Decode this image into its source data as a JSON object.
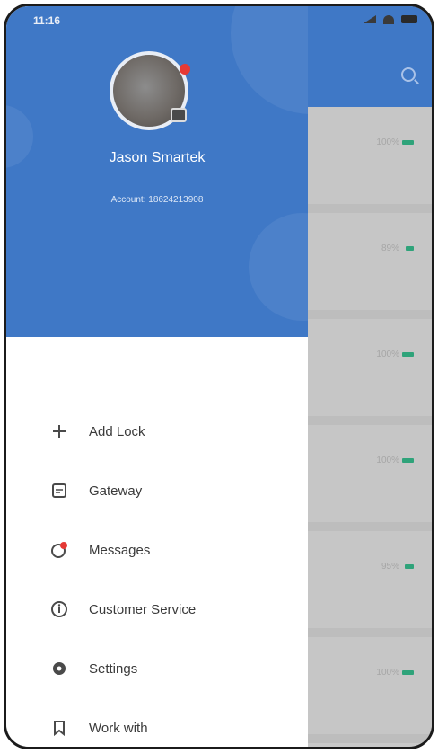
{
  "status_bar": {
    "time": "11:16"
  },
  "profile": {
    "name": "Jason Smartek",
    "account": "Account: 18624213908"
  },
  "menu": {
    "items": [
      {
        "label": "Add Lock",
        "icon": "plus-icon"
      },
      {
        "label": "Gateway",
        "icon": "gateway-icon"
      },
      {
        "label": "Messages",
        "icon": "messages-icon"
      },
      {
        "label": "Customer Service",
        "icon": "info-icon"
      },
      {
        "label": "Settings",
        "icon": "gear-icon"
      },
      {
        "label": "Work with",
        "icon": "bookmark-icon"
      }
    ]
  },
  "background_list": {
    "items": [
      {
        "battery": "100%"
      },
      {
        "battery": "89%"
      },
      {
        "battery": "100%"
      },
      {
        "battery": "100%"
      },
      {
        "battery": "95%"
      },
      {
        "battery": "100%"
      }
    ]
  },
  "colors": {
    "header_blue": "#3f78c6",
    "battery_green": "#2fa37a",
    "message_red": "#e53935"
  }
}
